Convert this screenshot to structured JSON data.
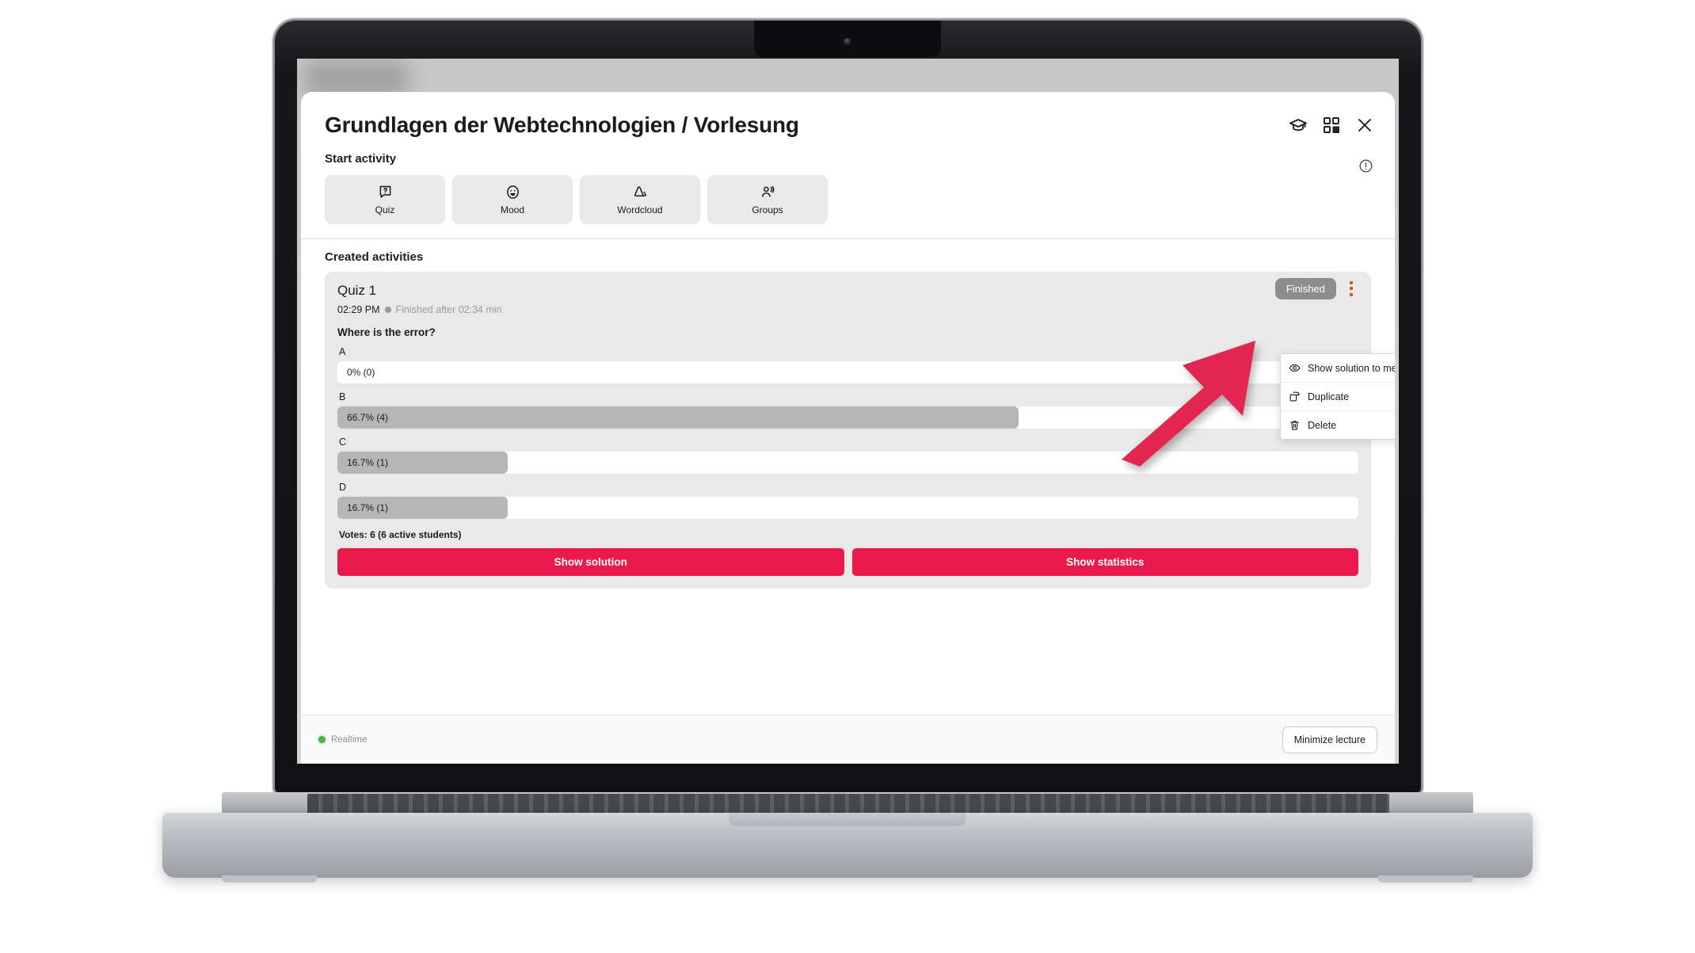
{
  "app": {
    "title": "Grundlagen der Webtechnologien / Vorlesung",
    "header_icons": [
      {
        "name": "graduation-cap-icon",
        "label": "Students view"
      },
      {
        "name": "qr-code-icon",
        "label": "QR code"
      },
      {
        "name": "close-icon",
        "label": "Close"
      }
    ],
    "info_icon": "info-circle-icon"
  },
  "start_activity": {
    "label": "Start activity",
    "buttons": [
      {
        "label": "Quiz",
        "icon": "quiz-question-bubble-icon"
      },
      {
        "label": "Mood",
        "icon": "mood-smiley-icon"
      },
      {
        "label": "Wordcloud",
        "icon": "cloud-icon"
      },
      {
        "label": "Groups",
        "icon": "groups-people-icon"
      }
    ]
  },
  "created_activities": {
    "label": "Created activities",
    "quiz": {
      "title": "Quiz 1",
      "time": "02:29 PM",
      "status_text": "Finished after 02:34 min",
      "badge": "Finished",
      "kebab_icon": "more-vertical-icon",
      "kebab_color": "#d2502e",
      "question": "Where is the error?",
      "votes_line": "Votes: 6 (6 active students)",
      "actions": [
        {
          "label": "Show solution"
        },
        {
          "label": "Show statistics"
        }
      ]
    }
  },
  "context_menu": {
    "items": [
      {
        "label": "Show solution to me",
        "icon": "eye-icon"
      },
      {
        "label": "Duplicate",
        "icon": "copy-icon"
      },
      {
        "label": "Delete",
        "icon": "trash-icon"
      }
    ]
  },
  "footer": {
    "realtime_label": "Realtime",
    "realtime_color": "#4caf50",
    "minimize_label": "Minimize lecture"
  },
  "annotation": {
    "arrow_color": "#e3274f",
    "points_to": "Duplicate"
  },
  "colors": {
    "accent_red": "#ea1b4c",
    "badge_grey": "#8d8d8d",
    "bar_fill": "#b6b6b6",
    "card_bg": "#e9e9e9"
  },
  "chart_data": {
    "type": "bar",
    "title": "Where is the error?",
    "categories": [
      "A",
      "B",
      "C",
      "D"
    ],
    "values": [
      0,
      66.7,
      16.7,
      16.7
    ],
    "counts": [
      0,
      4,
      1,
      1
    ],
    "labels": [
      "0% (0)",
      "66.7% (4)",
      "16.7% (1)",
      "16.7% (1)"
    ],
    "xlabel": "",
    "ylabel": "",
    "ylim": [
      0,
      100
    ],
    "total_votes": 6,
    "active_students": 6
  }
}
